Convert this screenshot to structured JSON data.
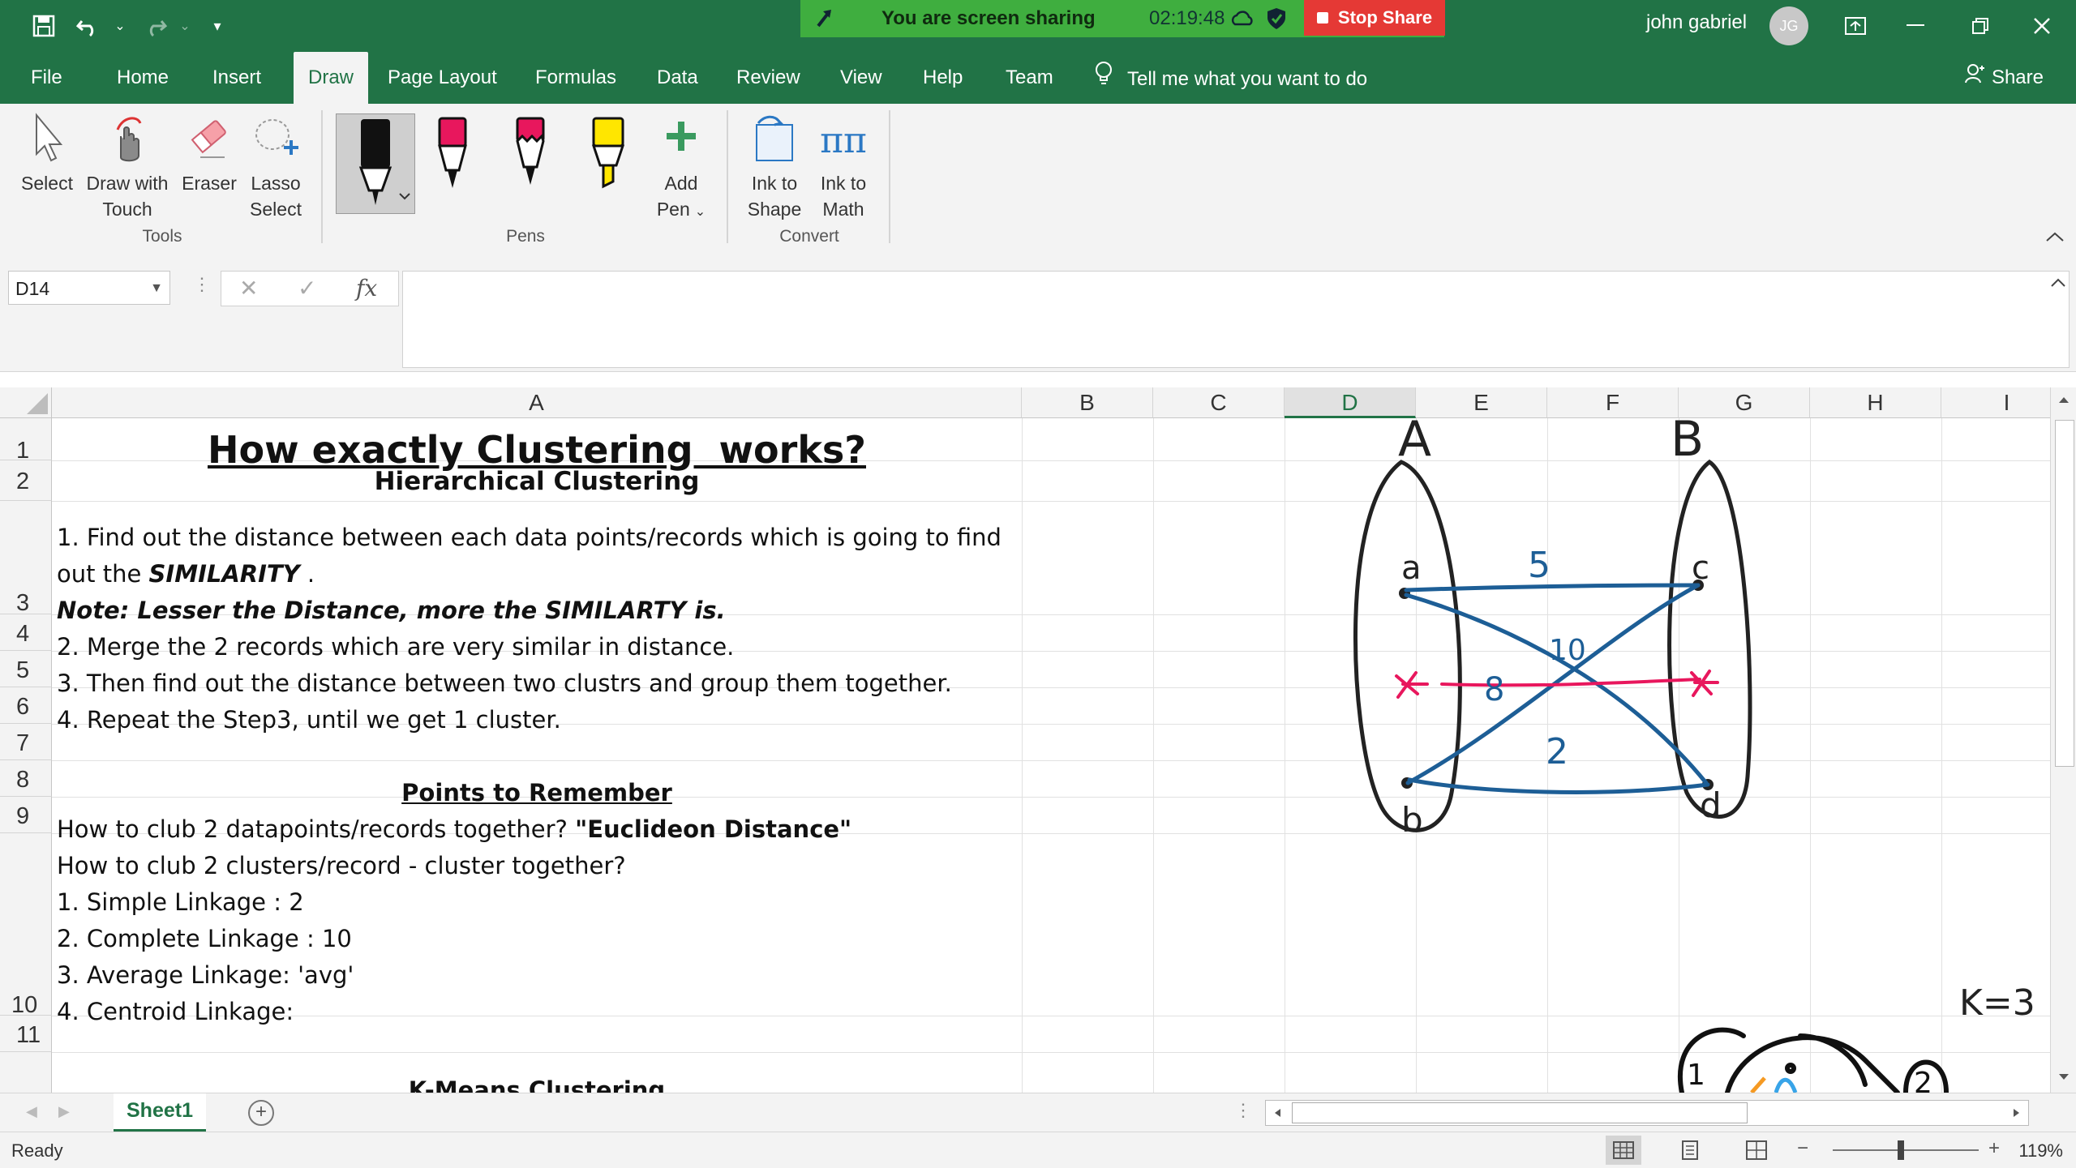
{
  "share": {
    "message": "You are screen sharing",
    "timer": "02:19:48",
    "stop_label": "Stop Share"
  },
  "user": {
    "name": "john gabriel",
    "initials": "JG"
  },
  "tabs": [
    "File",
    "Home",
    "Insert",
    "Draw",
    "Page Layout",
    "Formulas",
    "Data",
    "Review",
    "View",
    "Help",
    "Team"
  ],
  "active_tab": "Draw",
  "tellme": "Tell me what you want to do",
  "share_button": "Share",
  "ribbon": {
    "tools": {
      "select": "Select",
      "draw_touch_1": "Draw with",
      "draw_touch_2": "Touch",
      "eraser": "Eraser",
      "lasso_1": "Lasso",
      "lasso_2": "Select",
      "group": "Tools"
    },
    "pens": {
      "add_pen_1": "Add",
      "add_pen_2": "Pen",
      "group": "Pens",
      "colors": [
        "#111111",
        "#e8175d",
        "#e8175d",
        "#ffe600"
      ]
    },
    "convert": {
      "ink_shape_1": "Ink to",
      "ink_shape_2": "Shape",
      "ink_math_1": "Ink to",
      "ink_math_2": "Math",
      "group": "Convert"
    }
  },
  "formula_bar": {
    "name_box": "D14",
    "fx": "fx",
    "cancel": "✕",
    "enter": "✓",
    "value": ""
  },
  "columns": [
    "A",
    "B",
    "C",
    "D",
    "E",
    "F",
    "G",
    "H",
    "I"
  ],
  "selected_column": "D",
  "rows": [
    "1",
    "2",
    "3",
    "4",
    "5",
    "6",
    "7",
    "8",
    "9",
    "10",
    "11"
  ],
  "cells": {
    "a1": "How exactly Clustering  works?",
    "a2": "Hierarchical Clustering",
    "a3_line1": "1. Find out the distance between each data points/records which is going to find",
    "a3_line2_pre": "out the ",
    "a3_line2_bold": "SIMILARITY",
    "a3_line2_post": " .",
    "a3_line3": "Note: Lesser the Distance, more the SIMILARTY is.",
    "a4": "2. Merge the 2 records which are very similar in distance.",
    "a5": "3. Then find out the distance between two clustrs and group them together.",
    "a6": "4. Repeat the Step3, until we get 1 cluster.",
    "a8": "Points to Remember",
    "a9_pre": "How to club 2 datapoints/records together? ",
    "a9_bold": "\"Euclideon Distance\"",
    "a10_l1": "How to club 2 clusters/record - cluster together?",
    "a10_l2": "1. Simple Linkage : 2",
    "a10_l3": "2. Complete Linkage : 10",
    "a10_l4": "3. Average Linkage: 'avg'",
    "a10_l5": "4. Centroid Linkage:",
    "a12": "K-Means Clustering"
  },
  "ink": {
    "label_A": "A",
    "label_B": "B",
    "pt_a": "a",
    "pt_b": "b",
    "pt_c": "c",
    "pt_d": "d",
    "d5": "5",
    "d10": "10",
    "d8": "8",
    "d2": "2",
    "k": "K=3",
    "c1": "1",
    "c2": "2"
  },
  "sheet_tab": "Sheet1",
  "status": {
    "text": "Ready",
    "zoom": "119%"
  }
}
